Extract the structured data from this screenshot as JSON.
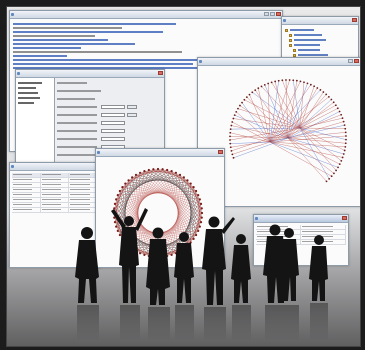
{
  "scene": {
    "description_label": ""
  },
  "windows": {
    "main_browser": {
      "title": "",
      "link_lines": 12
    },
    "tree_panel": {
      "title": "",
      "items": [
        "",
        "",
        "",
        "",
        "",
        "",
        "",
        ""
      ]
    },
    "settings_dialog": {
      "title": "",
      "tab_label": ""
    },
    "graph_window": {
      "title": ""
    },
    "table_window": {
      "title": ""
    },
    "circle_graph_window": {
      "title": ""
    },
    "small_dialog": {
      "title": ""
    }
  },
  "colors": {
    "link_blue": "#2b56b3",
    "edge_red": "#b0403a",
    "edge_blue": "#3d5fc4",
    "silhouette": "#141414"
  }
}
